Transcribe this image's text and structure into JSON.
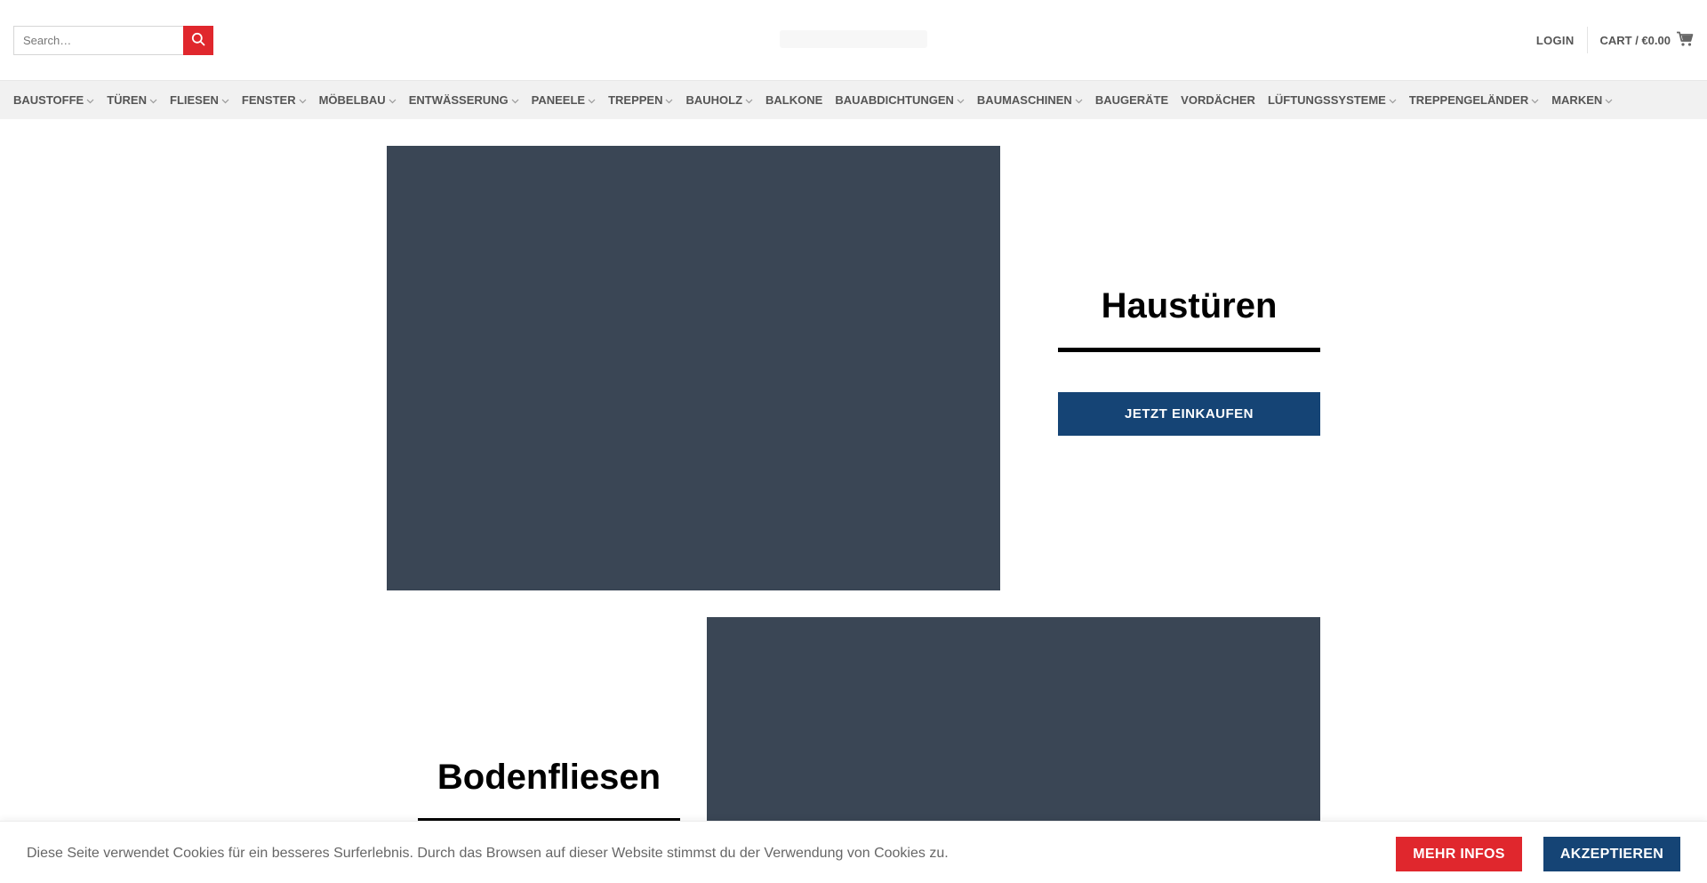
{
  "header": {
    "search_placeholder": "Search…",
    "login_label": "LOGIN",
    "cart_label": "CART / €0.00"
  },
  "nav": {
    "items": [
      {
        "label": "BAUSTOFFE",
        "has_dropdown": true
      },
      {
        "label": "TÜREN",
        "has_dropdown": true
      },
      {
        "label": "FLIESEN",
        "has_dropdown": true
      },
      {
        "label": "FENSTER",
        "has_dropdown": true
      },
      {
        "label": "MÖBELBAU",
        "has_dropdown": true
      },
      {
        "label": "ENTWÄSSERUNG",
        "has_dropdown": true
      },
      {
        "label": "PANEELE",
        "has_dropdown": true
      },
      {
        "label": "TREPPEN",
        "has_dropdown": true
      },
      {
        "label": "BAUHOLZ",
        "has_dropdown": true
      },
      {
        "label": "BALKONE",
        "has_dropdown": false
      },
      {
        "label": "BAUABDICHTUNGEN",
        "has_dropdown": true
      },
      {
        "label": "BAUMASCHINEN",
        "has_dropdown": true
      },
      {
        "label": "BAUGERÄTE",
        "has_dropdown": false
      },
      {
        "label": "VORDÄCHER",
        "has_dropdown": false
      },
      {
        "label": "LÜFTUNGSSYSTEME",
        "has_dropdown": true
      },
      {
        "label": "TREPPENGELÄNDER",
        "has_dropdown": true
      },
      {
        "label": "MARKEN",
        "has_dropdown": true
      }
    ]
  },
  "categories": [
    {
      "title": "Haustüren",
      "button_label": "JETZT EINKAUFEN"
    },
    {
      "title": "Bodenfliesen"
    }
  ],
  "cookie": {
    "text": "Diese Seite verwendet Cookies für ein besseres Surferlebnis. Durch das Browsen auf dieser Website stimmst du der Verwendung von Cookies zu.",
    "more_label": "MEHR INFOS",
    "accept_label": "AKZEPTIEREN"
  },
  "colors": {
    "accent_red": "#e0272d",
    "brand_blue": "#154475",
    "image_placeholder": "#3a4655",
    "nav_background": "#f1f1f1"
  },
  "icons": {
    "search": "search-icon",
    "cart": "cart-icon",
    "dropdown": "chevron-down-icon"
  }
}
